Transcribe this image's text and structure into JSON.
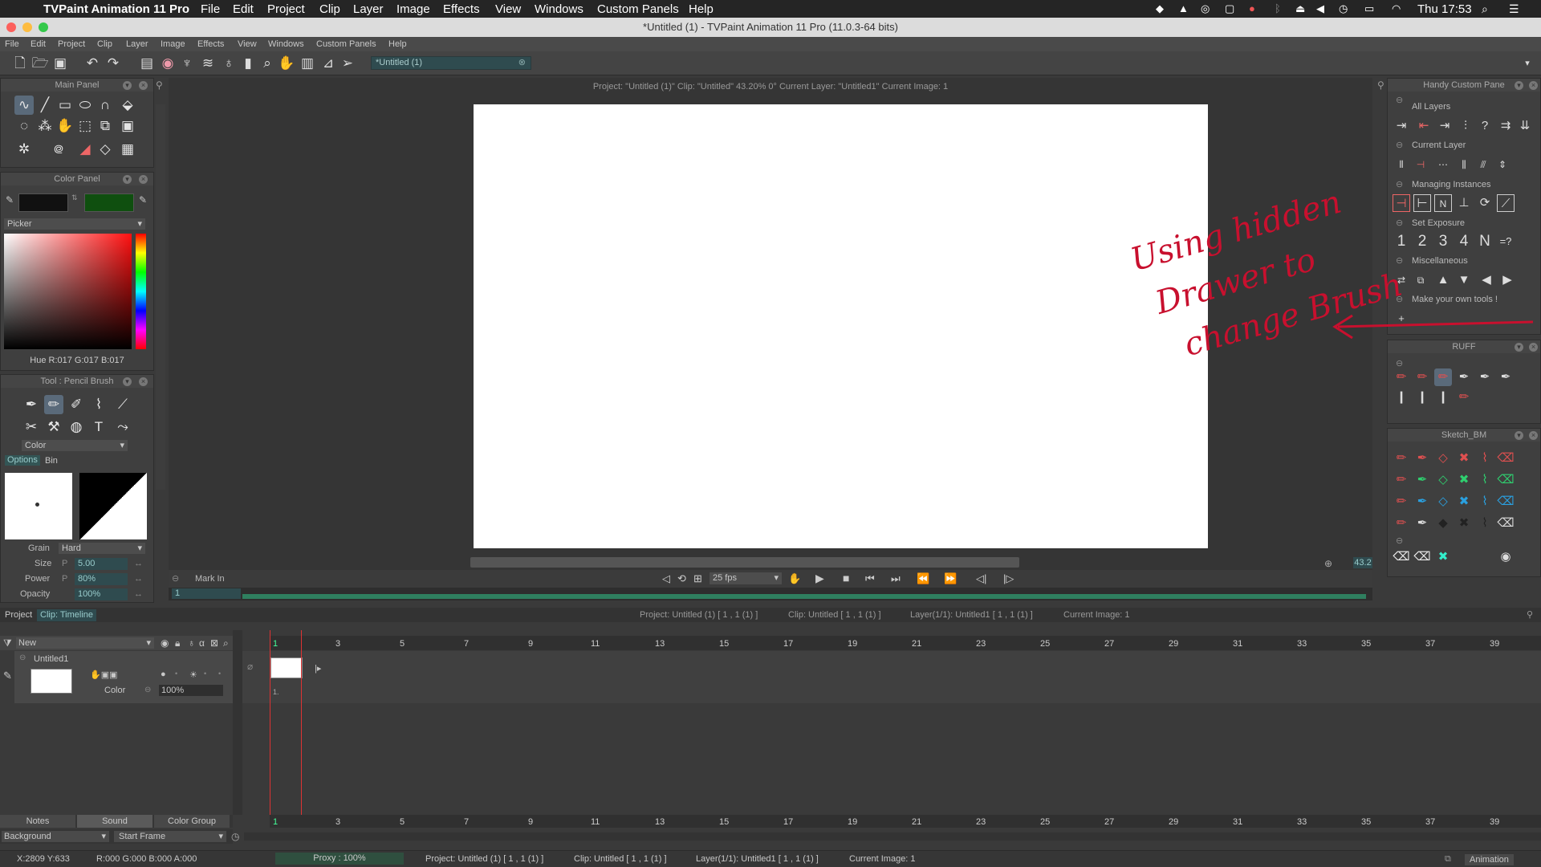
{
  "mac": {
    "apple": "",
    "app": "TVPaint Animation 11 Pro",
    "menus": [
      "File",
      "Edit",
      "Project",
      "Clip",
      "Layer",
      "Image",
      "Effects",
      "View",
      "Windows",
      "Custom Panels",
      "Help"
    ],
    "clock": "Thu 17:53"
  },
  "window": {
    "title": "*Untitled (1) - TVPaint Animation 11 Pro (11.0.3-64 bits)"
  },
  "appmenu": [
    "File",
    "Edit",
    "Project",
    "Clip",
    "Layer",
    "Image",
    "Effects",
    "View",
    "Windows",
    "Custom Panels",
    "Help"
  ],
  "toolbar": {
    "tab": "*Untitled (1)"
  },
  "main_panel": {
    "title": "Main Panel"
  },
  "color_panel": {
    "title": "Color Panel",
    "picker": "Picker",
    "hue": "Hue R:017 G:017 B:017"
  },
  "tool_panel": {
    "title": "Tool : Pencil Brush",
    "mode": "Color",
    "tab_options": "Options",
    "tab_bin": "Bin",
    "grain_label": "Grain",
    "grain": "Hard",
    "size_label": "Size",
    "size": "5.00",
    "power_label": "Power",
    "power": "80%",
    "opacity_label": "Opacity",
    "opacity": "100%",
    "p": "P"
  },
  "info": {
    "project": "Project:  \"Untitled (1)\"  Clip: \"Untitled\"   43.20%   0°  Current Layer: \"Untitled1\"  Current Image: 1",
    "zoom": "43.2"
  },
  "playback": {
    "mark_in": "Mark In",
    "fps": "25 fps",
    "frame": "1"
  },
  "handy": {
    "title": "Handy Custom Pane",
    "all_layers": "All Layers",
    "current_layer": "Current Layer",
    "managing": "Managing Instances",
    "set_exposure": "Set Exposure",
    "exp": [
      "1",
      "2",
      "3",
      "4",
      "N",
      "=?"
    ],
    "misc": "Miscellaneous",
    "make_own": "Make your own tools !",
    "plus": "+"
  },
  "ruff": {
    "title": "RUFF"
  },
  "sketch": {
    "title": "Sketch_BM"
  },
  "annotation": {
    "line1": "Using hidden",
    "line2": "Drawer to",
    "line3": "change Brush"
  },
  "timeline": {
    "tab_project": "Project",
    "tab_clip": "Clip: Timeline",
    "info_project": "Project: Untitled (1) [ 1 , 1  (1) ]",
    "info_clip": "Clip: Untitled [ 1 , 1  (1) ]",
    "info_layer": "Layer(1/1): Untitled1 [ 1 , 1  (1) ]",
    "info_image": "Current Image: 1",
    "new": "New",
    "layer_name": "Untitled1",
    "color_label": "Color",
    "opacity": "100%",
    "frame_mark": "1.",
    "ticks": [
      "1",
      "3",
      "5",
      "7",
      "9",
      "11",
      "13",
      "15",
      "17",
      "19",
      "21",
      "23",
      "25",
      "27",
      "29",
      "31",
      "33",
      "35",
      "37",
      "39"
    ],
    "notes": "Notes",
    "sound": "Sound",
    "color_group": "Color Group",
    "background": "Background",
    "start_frame": "Start Frame"
  },
  "status": {
    "coords": "X:2809  Y:633",
    "rgba": "R:000 G:000 B:000 A:000",
    "proxy": "Proxy : 100%",
    "project": "Project: Untitled (1) [ 1 , 1  (1) ]",
    "clip": "Clip: Untitled [ 1 , 1  (1) ]",
    "layer": "Layer(1/1): Untitled1 [ 1 , 1  (1) ]",
    "image": "Current Image: 1",
    "mode": "Animation"
  },
  "colors": {
    "accent_red": "#c8102e",
    "timeline_green": "#2f7f5f"
  }
}
